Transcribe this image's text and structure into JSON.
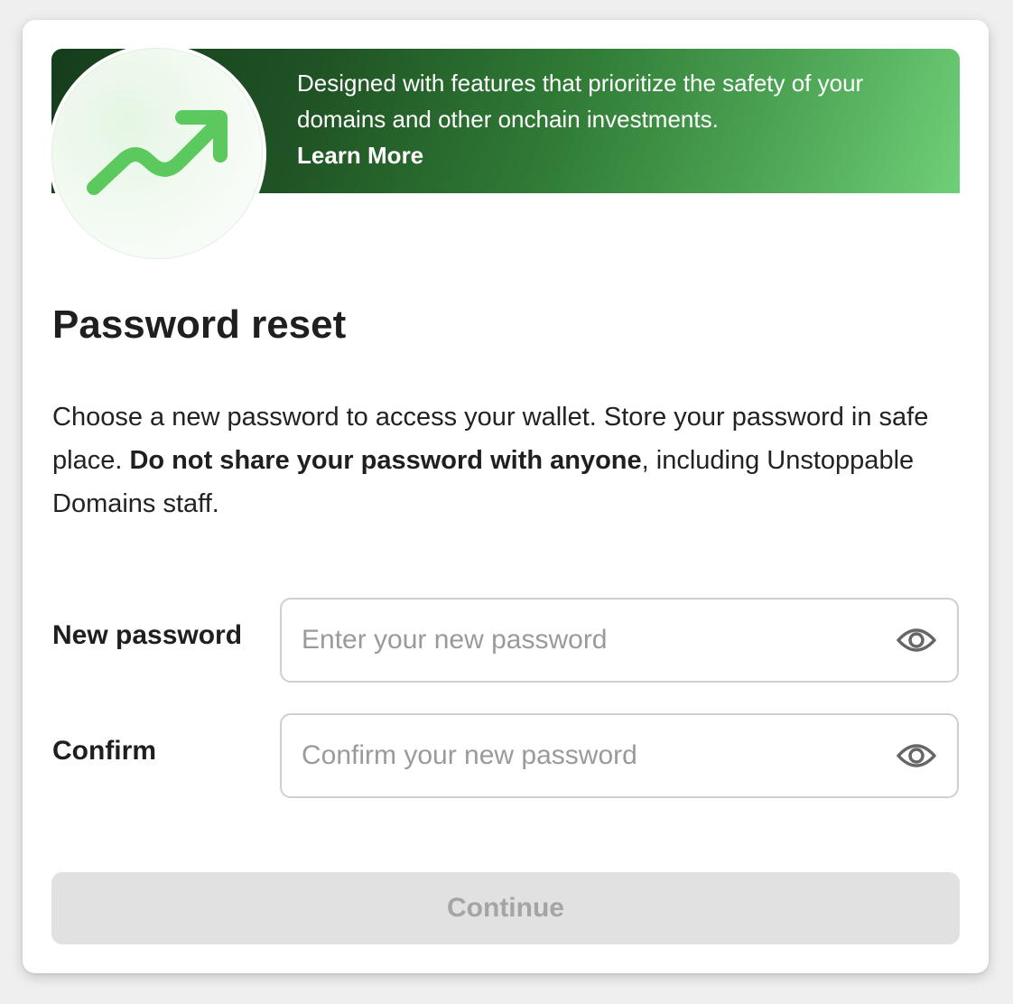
{
  "banner": {
    "text": "Designed with features that prioritize the safety of your domains and other onchain investments.",
    "link_label": "Learn More",
    "icon": "trending-up-icon",
    "gradient_colors": [
      "#163d1c",
      "#6fcf78"
    ]
  },
  "page": {
    "title": "Password reset",
    "description_before": "Choose a new password to access your wallet. Store your password in safe place. ",
    "description_bold": "Do not share your password with anyone",
    "description_after": ", including Unstoppable Domains staff."
  },
  "form": {
    "new_password": {
      "label": "New password",
      "placeholder": "Enter your new password",
      "value": "",
      "icon": "eye-icon"
    },
    "confirm": {
      "label": "Confirm",
      "placeholder": "Confirm your new password",
      "value": "",
      "icon": "eye-icon"
    },
    "submit_label": "Continue",
    "submit_enabled": false
  },
  "colors": {
    "accent_green": "#5cc95e",
    "disabled_button_bg": "#e1e1e1",
    "disabled_button_text": "#a4a4a4"
  }
}
